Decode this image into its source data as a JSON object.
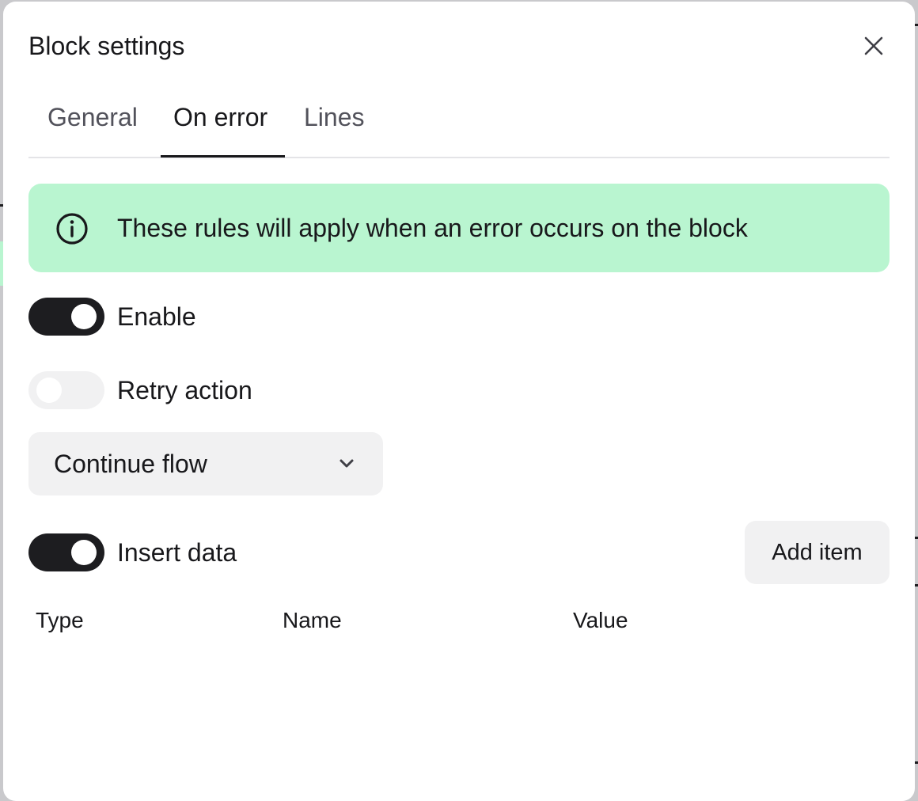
{
  "dialog": {
    "title": "Block settings",
    "close_icon": "close-icon"
  },
  "tabs": [
    {
      "label": "General",
      "active": false
    },
    {
      "label": "On error",
      "active": true
    },
    {
      "label": "Lines",
      "active": false
    }
  ],
  "alert": {
    "icon": "info-icon",
    "text": "These rules will apply when an error occurs on the block",
    "background": "#b9f5d0"
  },
  "toggles": {
    "enable": {
      "label": "Enable",
      "checked": true
    },
    "retry": {
      "label": "Retry action",
      "checked": false
    },
    "insert_data": {
      "label": "Insert data",
      "checked": true
    }
  },
  "action_select": {
    "value": "Continue flow",
    "icon": "chevron-down-icon"
  },
  "add_item_label": "Add item",
  "table": {
    "columns": [
      "Type",
      "Name",
      "Value"
    ]
  },
  "colors": {
    "toggle_on": "#1d1d20",
    "toggle_off": "#f1f1f2",
    "accent_text": "#18181b"
  }
}
